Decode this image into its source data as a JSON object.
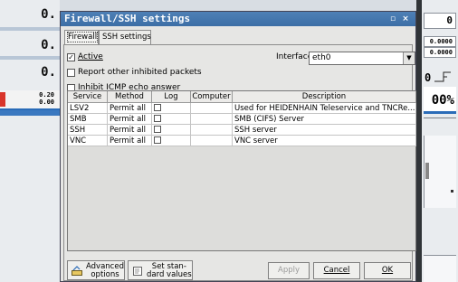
{
  "background": {
    "left_values": [
      "0.",
      "0.",
      "0."
    ],
    "left_small": [
      "0.20",
      "0.00"
    ],
    "right_values": [
      "0",
      "0.0000",
      "0.0000"
    ],
    "right_percent": "00%"
  },
  "dialog": {
    "title": "Firewall/SSH settings",
    "tabs": [
      {
        "label": "Firewall",
        "active": true
      },
      {
        "label": "SSH settings",
        "active": false
      }
    ],
    "active": {
      "label": "Active",
      "checked": true
    },
    "interface": {
      "label": "Interface",
      "value": "eth0"
    },
    "report": {
      "label": "Report other inhibited packets",
      "checked": false
    },
    "inhibit": {
      "label": "Inhibit ICMP echo answer",
      "checked": false
    },
    "table": {
      "columns": [
        "Service",
        "Method",
        "Log",
        "Computer",
        "Description"
      ],
      "rows": [
        {
          "service": "LSV2",
          "method": "Permit all",
          "log": false,
          "computer": "",
          "description": "Used for HEIDENHAIN Teleservice and TNCRe..."
        },
        {
          "service": "SMB",
          "method": "Permit all",
          "log": false,
          "computer": "",
          "description": "SMB (CIFS) Server"
        },
        {
          "service": "SSH",
          "method": "Permit all",
          "log": false,
          "computer": "",
          "description": "SSH server"
        },
        {
          "service": "VNC",
          "method": "Permit all",
          "log": false,
          "computer": "",
          "description": "VNC server"
        }
      ]
    },
    "buttons": {
      "advanced_1": "Advanced",
      "advanced_2": "options",
      "setstd_1": "Set stan-",
      "setstd_2": "dard values",
      "apply": "Apply",
      "cancel": "Cancel",
      "ok": "OK"
    },
    "colors": {
      "title_bar": "#3f72a9",
      "accent": "#2b6cb8"
    }
  }
}
